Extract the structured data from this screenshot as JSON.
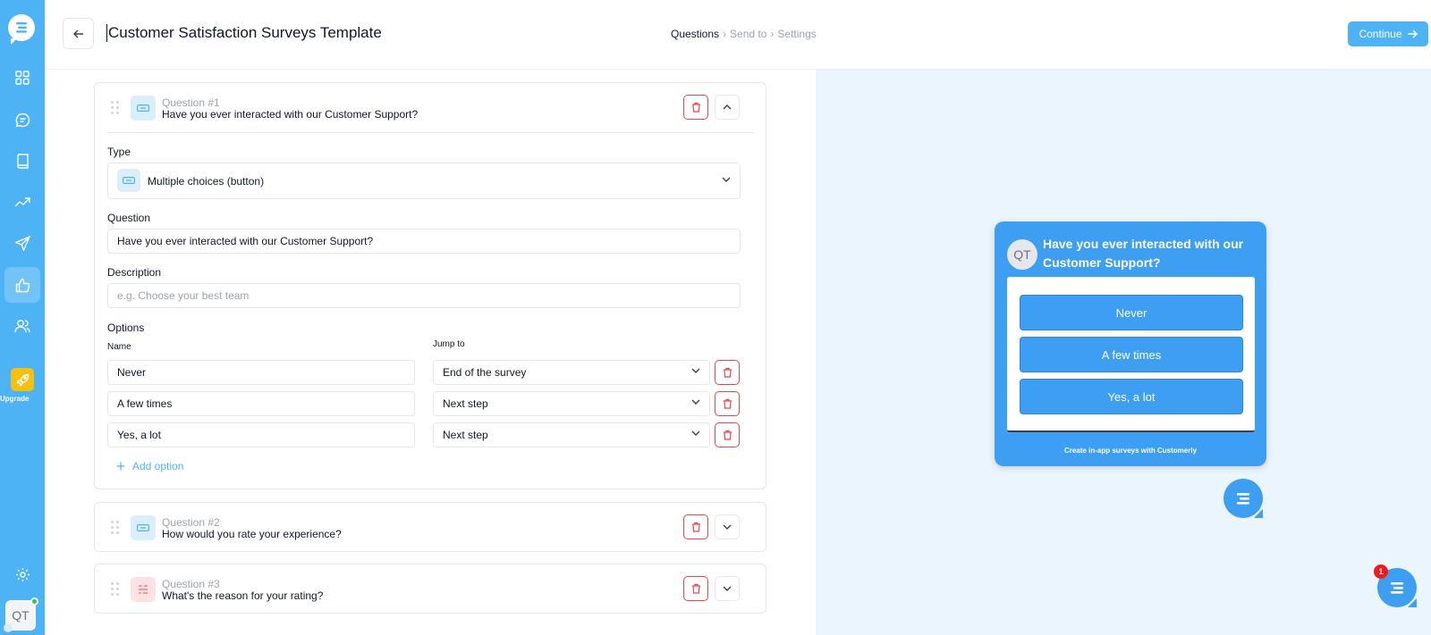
{
  "header": {
    "title": "Customer Satisfaction Surveys Template",
    "steps": [
      {
        "label": "Questions",
        "sep": "›"
      },
      {
        "label": "Send to",
        "sep": "›"
      },
      {
        "label": "Settings",
        "sep": ""
      }
    ],
    "continue_label": "Continue"
  },
  "sidebar": {
    "items": [
      {
        "name": "dashboard",
        "icon": "grid-icon"
      },
      {
        "name": "conversations",
        "icon": "chat-icon"
      },
      {
        "name": "knowledge-base",
        "icon": "book-icon"
      },
      {
        "name": "reports",
        "icon": "trend-icon"
      },
      {
        "name": "campaigns",
        "icon": "send-icon"
      },
      {
        "name": "surveys",
        "icon": "thumbs-up-icon",
        "active": true
      },
      {
        "name": "contacts",
        "icon": "users-icon"
      }
    ],
    "upgrade_label": "Upgrade",
    "avatar_initials": "QT"
  },
  "editor": {
    "questions": [
      {
        "number_label": "Question #1",
        "text": "Have you ever interacted with our Customer Support?",
        "expanded": true,
        "type_icon": "button-icon"
      },
      {
        "number_label": "Question #2",
        "text": "How would you rate your experience?",
        "expanded": false,
        "type_icon": "button-icon"
      },
      {
        "number_label": "Question #3",
        "text": "What's the reason for your rating?",
        "expanded": false,
        "type_icon": "text-lines-icon"
      }
    ],
    "type_label": "Type",
    "type_value": "Multiple choices (button)",
    "question_label": "Question",
    "question_value": "Have you ever interacted with our Customer Support?",
    "description_label": "Description",
    "description_placeholder": "e.g. Choose your best team",
    "options_label": "Options",
    "name_col_label": "Name",
    "jump_col_label": "Jump to",
    "options": [
      {
        "name": "Never",
        "jump": "End of the survey"
      },
      {
        "name": "A few times",
        "jump": "Next step"
      },
      {
        "name": "Yes, a lot",
        "jump": "Next step"
      }
    ],
    "add_option_label": "Add option"
  },
  "preview": {
    "avatar_initials": "QT",
    "title": "Have you ever interacted with our Customer Support?",
    "options": [
      "Never",
      "A few times",
      "Yes, a lot"
    ],
    "footer": "Create in-app surveys with Customerly",
    "badge_count": "1"
  },
  "colors": {
    "brand": "#4db3f5",
    "widget": "#3d9ef2",
    "danger": "#ef4444",
    "preview_bg": "#ebf5fd"
  }
}
